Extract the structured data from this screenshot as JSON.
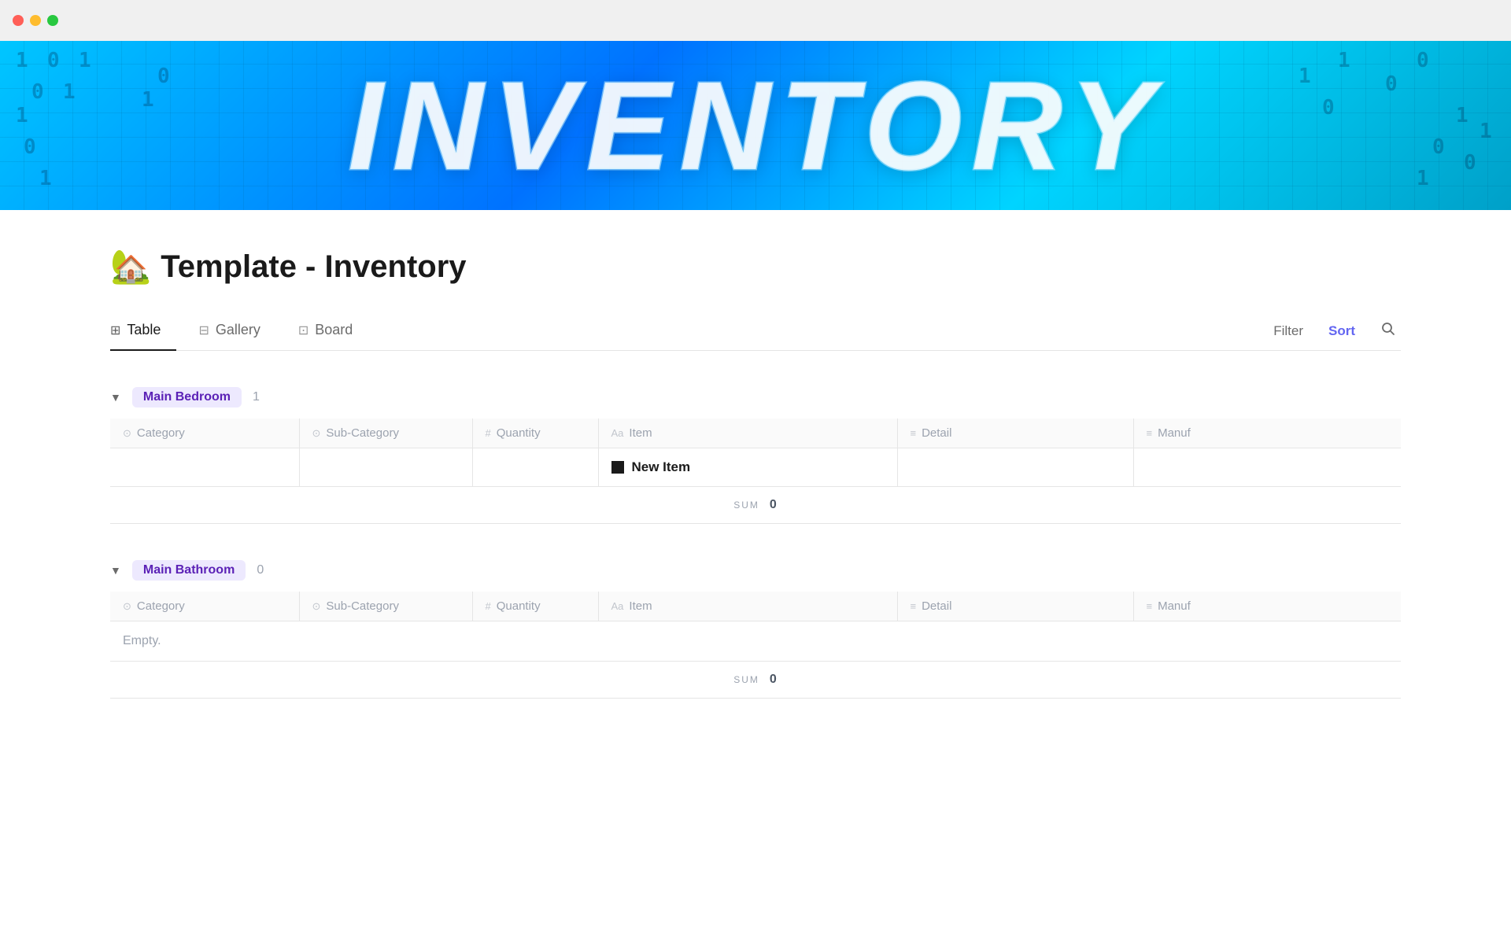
{
  "titlebar": {
    "close_label": "",
    "minimize_label": "",
    "maximize_label": ""
  },
  "hero": {
    "title": "INVENTORY"
  },
  "page": {
    "emoji": "🏡",
    "title": "Template - Inventory"
  },
  "tabs": [
    {
      "id": "table",
      "label": "Table",
      "icon": "⊞",
      "active": true
    },
    {
      "id": "gallery",
      "label": "Gallery",
      "icon": "⊟",
      "active": false
    },
    {
      "id": "board",
      "label": "Board",
      "icon": "⊡",
      "active": false
    }
  ],
  "toolbar": {
    "filter_label": "Filter",
    "sort_label": "Sort",
    "search_icon": "🔍"
  },
  "columns": [
    {
      "id": "category",
      "label": "Category",
      "icon_type": "select"
    },
    {
      "id": "subcategory",
      "label": "Sub-Category",
      "icon_type": "select"
    },
    {
      "id": "quantity",
      "label": "Quantity",
      "icon_type": "number"
    },
    {
      "id": "item",
      "label": "Item",
      "icon_type": "text"
    },
    {
      "id": "detail",
      "label": "Detail",
      "icon_type": "lines"
    },
    {
      "id": "manuf",
      "label": "Manuf",
      "icon_type": "lines"
    }
  ],
  "groups": [
    {
      "id": "main-bedroom",
      "label": "Main Bedroom",
      "count": 1,
      "rows": [
        {
          "category": "",
          "subcategory": "",
          "quantity": "",
          "item": "New Item",
          "detail": "",
          "manuf": ""
        }
      ],
      "sum": 0,
      "empty": false
    },
    {
      "id": "main-bathroom",
      "label": "Main Bathroom",
      "count": 0,
      "rows": [],
      "sum": 0,
      "empty": true
    }
  ],
  "labels": {
    "sum": "SUM",
    "empty": "Empty.",
    "new_item": "New Item"
  }
}
